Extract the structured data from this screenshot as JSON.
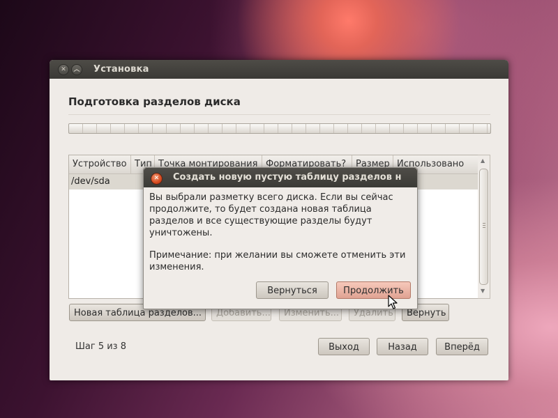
{
  "window": {
    "title": "Установка",
    "heading": "Подготовка разделов диска",
    "progress": 0
  },
  "table": {
    "columns": [
      "Устройство",
      "Тип",
      "Точка монтирования",
      "Форматировать?",
      "Размер",
      "Использовано"
    ],
    "rows": [
      {
        "device": "/dev/sda"
      }
    ]
  },
  "partition_buttons": {
    "new_table": "Новая таблица разделов...",
    "add": "Добавить...",
    "change": "Изменить...",
    "delete": "Удалить",
    "revert": "Вернуть"
  },
  "footer": {
    "step": "Шаг 5 из 8",
    "quit": "Выход",
    "back": "Назад",
    "forward": "Вперёд"
  },
  "dialog": {
    "title": "Создать новую пустую таблицу разделов н",
    "message": "Вы выбрали разметку всего диска. Если вы сейчас продолжите, то будет создана новая таблица разделов и все существующие разделы будут уничтожены.",
    "note": "Примечание: при желании вы сможете отменить эти изменения.",
    "back_button": "Вернуться",
    "continue_button": "Продолжить"
  },
  "colors": {
    "dialog_primary": "#e0a292",
    "titlebar": "#3a3935"
  }
}
